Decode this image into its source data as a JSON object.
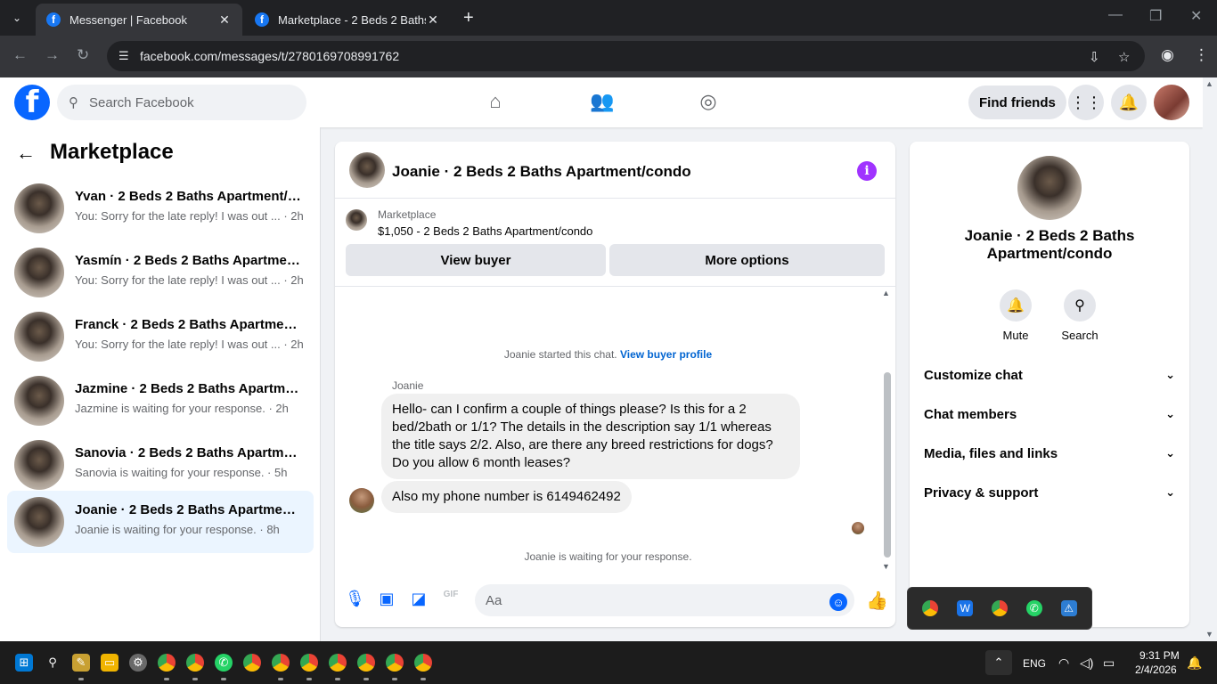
{
  "browser": {
    "tabs": [
      {
        "title": "Messenger | Facebook",
        "close": "✕"
      },
      {
        "title": "Marketplace - 2 Beds 2 Baths Ap",
        "close": "✕"
      }
    ],
    "new_tab": "+",
    "url": "facebook.com/messages/t/2780169708991762"
  },
  "fb": {
    "logo": "f",
    "search_placeholder": "Search Facebook",
    "find_friends": "Find friends"
  },
  "sidebar": {
    "title": "Marketplace",
    "chats": [
      {
        "name": "Yvan · 2 Beds 2 Baths Apartment/c...",
        "preview": "You: Sorry for the late reply! I was out ... · 2h"
      },
      {
        "name": "Yasmín · 2 Beds 2 Baths Apartmen...",
        "preview": "You: Sorry for the late reply! I was out ... · 2h"
      },
      {
        "name": "Franck · 2 Beds 2 Baths Apartment...",
        "preview": "You: Sorry for the late reply! I was out ... · 2h"
      },
      {
        "name": "Jazmine · 2 Beds 2 Baths Apartme...",
        "preview": "Jazmine is waiting for your response. · 2h"
      },
      {
        "name": "Sanovia · 2 Beds 2 Baths Apartme...",
        "preview": "Sanovia is waiting for your response. · 5h"
      },
      {
        "name": "Joanie · 2 Beds 2 Baths Apartment...",
        "preview": "Joanie is waiting for your response. · 8h"
      }
    ]
  },
  "chat": {
    "title": "Joanie · 2 Beds 2 Baths Apartment/condo",
    "info_icon": "i",
    "marketplace_label": "Marketplace",
    "listing": "$1,050 - 2 Beds 2 Baths Apartment/condo",
    "view_buyer": "View buyer",
    "more_options": "More options",
    "started_text": "Joanie started this chat.",
    "view_buyer_profile": "View buyer profile",
    "sender": "Joanie",
    "messages": [
      "Hello- can I confirm a couple of things please? Is this for a 2 bed/2bath or 1/1? The details in the description say 1/1 whereas the title says 2/2. Also, are there any breed restrictions for dogs? Do you allow 6 month leases?",
      "Also my phone number is 6149462492"
    ],
    "waiting": "Joanie is waiting for your response.",
    "composer_placeholder": "Aa"
  },
  "right_panel": {
    "name": "Joanie · 2 Beds 2 Baths Apartment/condo",
    "actions": [
      {
        "label": "Mute",
        "icon": "bell-icon"
      },
      {
        "label": "Search",
        "icon": "search-icon"
      }
    ],
    "sections": [
      "Customize chat",
      "Chat members",
      "Media, files and links",
      "Privacy & support"
    ]
  },
  "taskbar": {
    "language": "ENG",
    "time": "9:31 PM",
    "date": "2/4/2026"
  },
  "colors": {
    "fb_blue": "#0866ff",
    "selected_bg": "#ebf5ff",
    "info_purple": "#a033ff"
  }
}
